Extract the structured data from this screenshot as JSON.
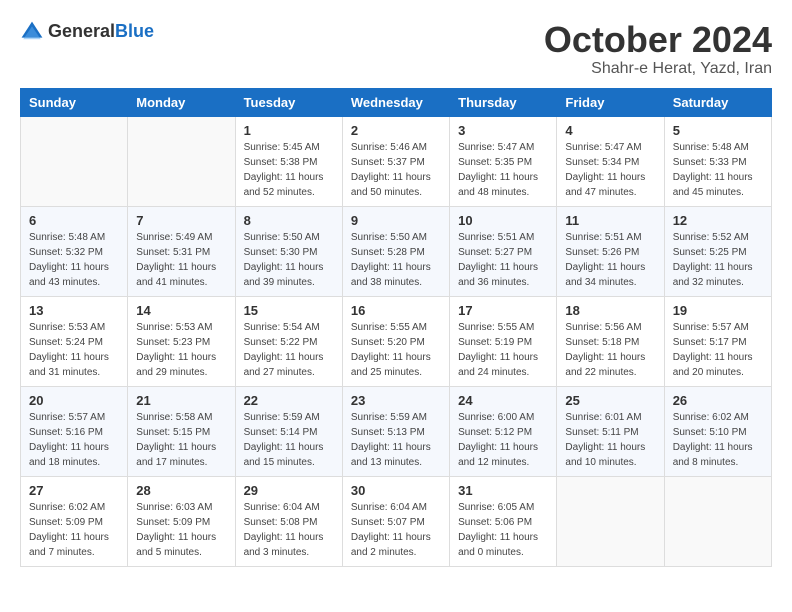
{
  "header": {
    "logo_general": "General",
    "logo_blue": "Blue",
    "month_title": "October 2024",
    "location": "Shahr-e Herat, Yazd, Iran"
  },
  "days_of_week": [
    "Sunday",
    "Monday",
    "Tuesday",
    "Wednesday",
    "Thursday",
    "Friday",
    "Saturday"
  ],
  "weeks": [
    [
      {
        "day": "",
        "info": ""
      },
      {
        "day": "",
        "info": ""
      },
      {
        "day": "1",
        "info": "Sunrise: 5:45 AM\nSunset: 5:38 PM\nDaylight: 11 hours and 52 minutes."
      },
      {
        "day": "2",
        "info": "Sunrise: 5:46 AM\nSunset: 5:37 PM\nDaylight: 11 hours and 50 minutes."
      },
      {
        "day": "3",
        "info": "Sunrise: 5:47 AM\nSunset: 5:35 PM\nDaylight: 11 hours and 48 minutes."
      },
      {
        "day": "4",
        "info": "Sunrise: 5:47 AM\nSunset: 5:34 PM\nDaylight: 11 hours and 47 minutes."
      },
      {
        "day": "5",
        "info": "Sunrise: 5:48 AM\nSunset: 5:33 PM\nDaylight: 11 hours and 45 minutes."
      }
    ],
    [
      {
        "day": "6",
        "info": "Sunrise: 5:48 AM\nSunset: 5:32 PM\nDaylight: 11 hours and 43 minutes."
      },
      {
        "day": "7",
        "info": "Sunrise: 5:49 AM\nSunset: 5:31 PM\nDaylight: 11 hours and 41 minutes."
      },
      {
        "day": "8",
        "info": "Sunrise: 5:50 AM\nSunset: 5:30 PM\nDaylight: 11 hours and 39 minutes."
      },
      {
        "day": "9",
        "info": "Sunrise: 5:50 AM\nSunset: 5:28 PM\nDaylight: 11 hours and 38 minutes."
      },
      {
        "day": "10",
        "info": "Sunrise: 5:51 AM\nSunset: 5:27 PM\nDaylight: 11 hours and 36 minutes."
      },
      {
        "day": "11",
        "info": "Sunrise: 5:51 AM\nSunset: 5:26 PM\nDaylight: 11 hours and 34 minutes."
      },
      {
        "day": "12",
        "info": "Sunrise: 5:52 AM\nSunset: 5:25 PM\nDaylight: 11 hours and 32 minutes."
      }
    ],
    [
      {
        "day": "13",
        "info": "Sunrise: 5:53 AM\nSunset: 5:24 PM\nDaylight: 11 hours and 31 minutes."
      },
      {
        "day": "14",
        "info": "Sunrise: 5:53 AM\nSunset: 5:23 PM\nDaylight: 11 hours and 29 minutes."
      },
      {
        "day": "15",
        "info": "Sunrise: 5:54 AM\nSunset: 5:22 PM\nDaylight: 11 hours and 27 minutes."
      },
      {
        "day": "16",
        "info": "Sunrise: 5:55 AM\nSunset: 5:20 PM\nDaylight: 11 hours and 25 minutes."
      },
      {
        "day": "17",
        "info": "Sunrise: 5:55 AM\nSunset: 5:19 PM\nDaylight: 11 hours and 24 minutes."
      },
      {
        "day": "18",
        "info": "Sunrise: 5:56 AM\nSunset: 5:18 PM\nDaylight: 11 hours and 22 minutes."
      },
      {
        "day": "19",
        "info": "Sunrise: 5:57 AM\nSunset: 5:17 PM\nDaylight: 11 hours and 20 minutes."
      }
    ],
    [
      {
        "day": "20",
        "info": "Sunrise: 5:57 AM\nSunset: 5:16 PM\nDaylight: 11 hours and 18 minutes."
      },
      {
        "day": "21",
        "info": "Sunrise: 5:58 AM\nSunset: 5:15 PM\nDaylight: 11 hours and 17 minutes."
      },
      {
        "day": "22",
        "info": "Sunrise: 5:59 AM\nSunset: 5:14 PM\nDaylight: 11 hours and 15 minutes."
      },
      {
        "day": "23",
        "info": "Sunrise: 5:59 AM\nSunset: 5:13 PM\nDaylight: 11 hours and 13 minutes."
      },
      {
        "day": "24",
        "info": "Sunrise: 6:00 AM\nSunset: 5:12 PM\nDaylight: 11 hours and 12 minutes."
      },
      {
        "day": "25",
        "info": "Sunrise: 6:01 AM\nSunset: 5:11 PM\nDaylight: 11 hours and 10 minutes."
      },
      {
        "day": "26",
        "info": "Sunrise: 6:02 AM\nSunset: 5:10 PM\nDaylight: 11 hours and 8 minutes."
      }
    ],
    [
      {
        "day": "27",
        "info": "Sunrise: 6:02 AM\nSunset: 5:09 PM\nDaylight: 11 hours and 7 minutes."
      },
      {
        "day": "28",
        "info": "Sunrise: 6:03 AM\nSunset: 5:09 PM\nDaylight: 11 hours and 5 minutes."
      },
      {
        "day": "29",
        "info": "Sunrise: 6:04 AM\nSunset: 5:08 PM\nDaylight: 11 hours and 3 minutes."
      },
      {
        "day": "30",
        "info": "Sunrise: 6:04 AM\nSunset: 5:07 PM\nDaylight: 11 hours and 2 minutes."
      },
      {
        "day": "31",
        "info": "Sunrise: 6:05 AM\nSunset: 5:06 PM\nDaylight: 11 hours and 0 minutes."
      },
      {
        "day": "",
        "info": ""
      },
      {
        "day": "",
        "info": ""
      }
    ]
  ]
}
